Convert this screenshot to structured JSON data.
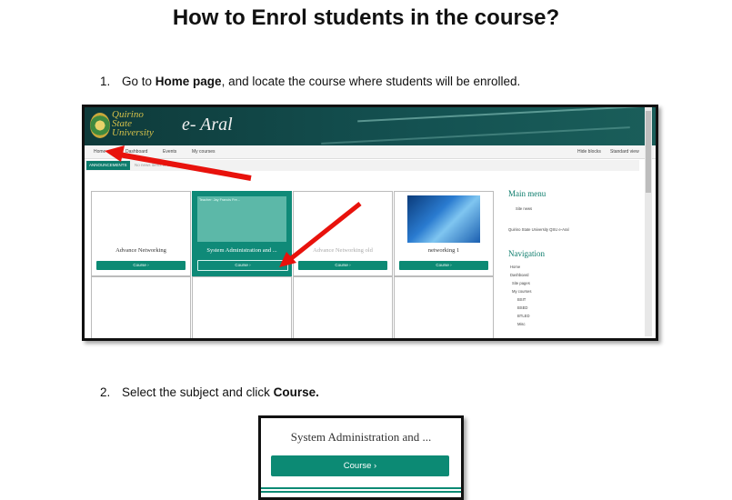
{
  "title": "How to Enrol students in the course?",
  "steps": [
    {
      "number": "1.",
      "pre": "Go to ",
      "bold": "Home page",
      "post": ", and locate the course where students will be enrolled."
    },
    {
      "number": "2.",
      "pre": "Select the subject and click ",
      "bold": "Course.",
      "post": ""
    }
  ],
  "screenshot1": {
    "logo_lines": [
      "Quirino",
      "State",
      "University"
    ],
    "brand": "e- Aral",
    "nav": {
      "home": "Home",
      "dashboard": "Dashboard",
      "events": "Events",
      "my_courses": "My courses",
      "hide_blocks": "Hide blocks",
      "standard_view": "Standard view"
    },
    "announcements_label": "ANNOUNCEMENTS",
    "announcements_text": "No news items to display",
    "courses": [
      {
        "name": "Advance Networking",
        "button": "Course ›"
      },
      {
        "name": "System Administration and ...",
        "button": "Course ›",
        "teacher": "Teacher: Jay Francis Fre..."
      },
      {
        "name": "Advance Networking old",
        "button": "Course ›"
      },
      {
        "name": "networking 1",
        "button": "Course ›"
      }
    ],
    "sidebar": {
      "main_menu": "Main menu",
      "site_news": "Site news",
      "site_name": "Quirino State University QSU e-Aral",
      "navigation": "Navigation",
      "nav_items": [
        "Home",
        "Dashboard",
        "Site pages",
        "My courses",
        "BSIT",
        "BSED",
        "BTLED",
        "Misc"
      ]
    },
    "accent_color": "#0c8a74",
    "arrow_color": "#e8120c"
  },
  "screenshot2": {
    "course_name": "System Administration and ...",
    "button": "Course ›"
  }
}
